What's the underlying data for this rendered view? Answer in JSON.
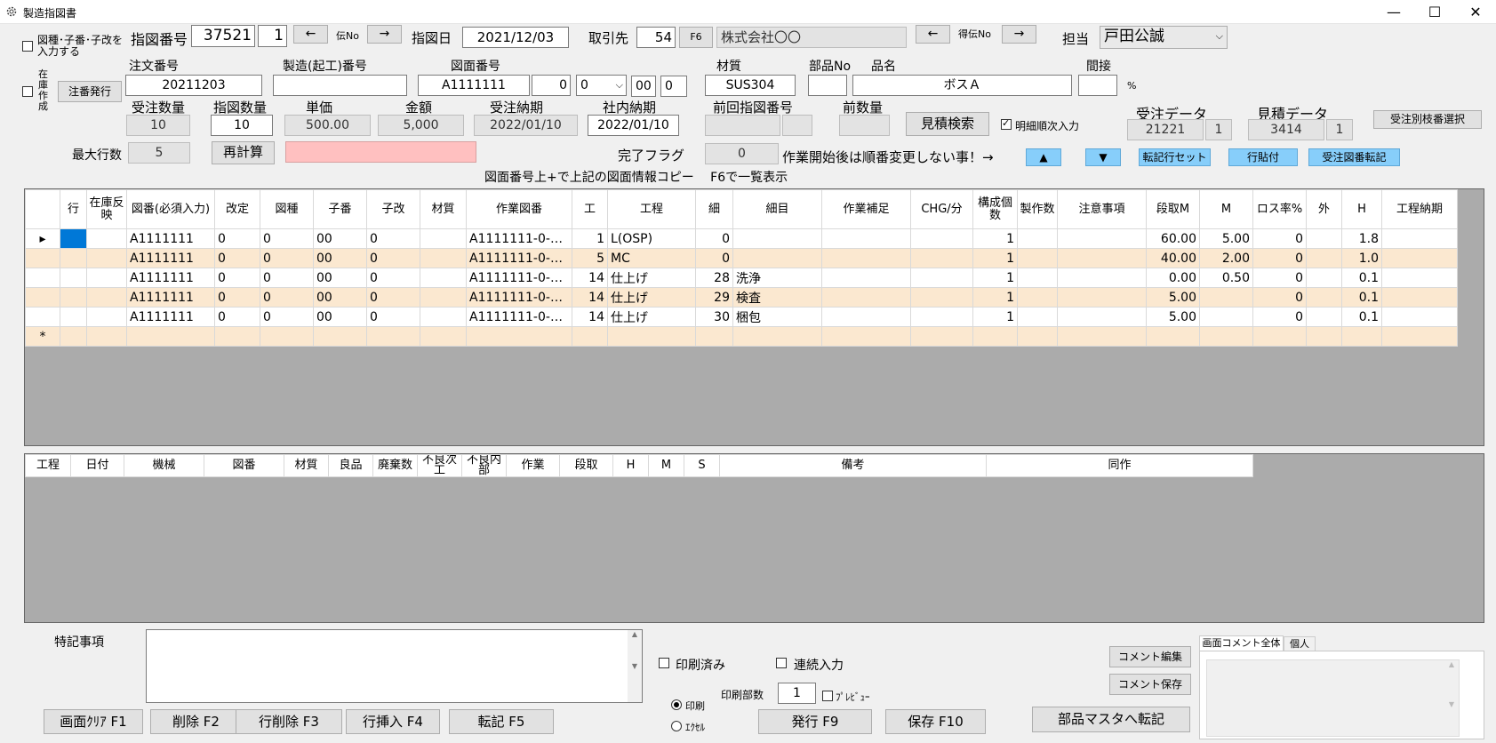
{
  "window": {
    "title": "製造指図書",
    "min": "—",
    "max": "☐",
    "close": "✕"
  },
  "top": {
    "chk_input_label": "図種･子番･子改を入力する",
    "chk_stock_label": "在庫作成",
    "order_issue_btn": "注番発行",
    "shizu_label": "指図番号",
    "shizu_no": "37521",
    "shizu_sub": "1",
    "arrow_left": "←",
    "arrow_right": "→",
    "den_no_label": "伝No",
    "date_label": "指図日",
    "date": "2021/12/03",
    "client_label": "取引先",
    "client_code": "54",
    "f6": "F6",
    "client_name": "株式会社〇〇",
    "tokuden_label": "得伝No",
    "tanto_label": "担当",
    "tanto": "戸田公誠"
  },
  "row2": {
    "order_no_label": "注文番号",
    "order_no": "20211203",
    "mfg_no_label": "製造(起工)番号",
    "mfg_no": "",
    "drawing_label": "図面番号",
    "drawing_no": "A1111111",
    "drawing_a": "0",
    "drawing_b": "0",
    "drawing_c": "00",
    "drawing_d": "0",
    "material_label": "材質",
    "material": "SUS304",
    "part_no_label": "部品No",
    "part_no": "",
    "name_label": "品名",
    "name": "ボスＡ",
    "indirect_label": "間接",
    "indirect": "",
    "percent": "%"
  },
  "row3": {
    "order_qty_label": "受注数量",
    "order_qty": "10",
    "shizu_qty_label": "指図数量",
    "shizu_qty": "10",
    "price_label": "単価",
    "price": "500.00",
    "amount_label": "金額",
    "amount": "5,000",
    "due_label": "受注納期",
    "due": "2022/01/10",
    "internal_due_label": "社内納期",
    "internal_due": "2022/01/10",
    "prev_label": "前回指図番号",
    "prev_a": "",
    "prev_b": "",
    "prev_qty_label": "前数量",
    "prev_qty": "",
    "estimate_search": "見積検索",
    "detail_order_label": "明細順次入力",
    "order_data_label": "受注データ",
    "order_data_a": "21221",
    "order_data_b": "1",
    "est_data_label": "見積データ",
    "est_data_a": "3414",
    "est_data_b": "1",
    "branch_select": "受注別枝番選択"
  },
  "row4": {
    "max_rows_label": "最大行数",
    "max_rows": "5",
    "recalc": "再計算",
    "done_flag_label": "完了フラグ",
    "done_flag": "0",
    "warning": "作業開始後は順番変更しない事！→",
    "up": "▲",
    "down": "▼",
    "set_btn": "転記行セット",
    "paste_btn": "行貼付",
    "transfer_btn": "受注図番転記",
    "hint": "図面番号上+で上記の図面情報コピー　 F6で一覧表示"
  },
  "grid1": {
    "headers": [
      "",
      "行",
      "在庫反映",
      "図番(必須入力)",
      "改定",
      "図種",
      "子番",
      "子改",
      "材質",
      "作業図番",
      "工",
      "工程",
      "細",
      "細目",
      "作業補足",
      "CHG/分",
      "構成個数",
      "製作数",
      "注意事項",
      "段取M",
      "M",
      "ロス率%",
      "外",
      "H",
      "工程納期"
    ],
    "rows": [
      [
        "▸",
        "",
        "",
        "A1111111",
        "0",
        "0",
        "00",
        "0",
        "",
        "A1111111-0-0...",
        "1",
        "L(OSP)",
        "0",
        "",
        "",
        "",
        "1",
        "",
        "",
        "60.00",
        "5.00",
        "0",
        "",
        "1.8",
        ""
      ],
      [
        "",
        "",
        "",
        "A1111111",
        "0",
        "0",
        "00",
        "0",
        "",
        "A1111111-0-0...",
        "5",
        "MC",
        "0",
        "",
        "",
        "",
        "1",
        "",
        "",
        "40.00",
        "2.00",
        "0",
        "",
        "1.0",
        ""
      ],
      [
        "",
        "",
        "",
        "A1111111",
        "0",
        "0",
        "00",
        "0",
        "",
        "A1111111-0-0...",
        "14",
        "仕上げ",
        "28",
        "洗浄",
        "",
        "",
        "1",
        "",
        "",
        "0.00",
        "0.50",
        "0",
        "",
        "0.1",
        ""
      ],
      [
        "",
        "",
        "",
        "A1111111",
        "0",
        "0",
        "00",
        "0",
        "",
        "A1111111-0-0...",
        "14",
        "仕上げ",
        "29",
        "検査",
        "",
        "",
        "1",
        "",
        "",
        "5.00",
        "",
        "0",
        "",
        "0.1",
        ""
      ],
      [
        "",
        "",
        "",
        "A1111111",
        "0",
        "0",
        "00",
        "0",
        "",
        "A1111111-0-0...",
        "14",
        "仕上げ",
        "30",
        "梱包",
        "",
        "",
        "1",
        "",
        "",
        "5.00",
        "",
        "0",
        "",
        "0.1",
        ""
      ]
    ],
    "new_row": "*"
  },
  "grid2": {
    "headers": [
      "工程",
      "日付",
      "機械",
      "図番",
      "材質",
      "良品",
      "廃棄数",
      "不良次工",
      "不良内部",
      "作業",
      "段取",
      "H",
      "M",
      "S",
      "備考",
      "同作"
    ]
  },
  "bottom": {
    "notes_label": "特記事項",
    "notes": "",
    "printed": "印刷済み",
    "continuous": "連続入力",
    "copies_label": "印刷部数",
    "copies": "1",
    "preview": "ﾌﾟﾚﾋﾞｭｰ",
    "print_radio": "印刷",
    "excel_radio": "ｴｸｾﾙ",
    "comment_edit": "コメント編集",
    "comment_save": "コメント保存",
    "tab_all": "画面コメント全体",
    "tab_personal": "個人",
    "clear": "画面ｸﾘｱ F1",
    "delete": "削除 F2",
    "row_delete": "行削除 F3",
    "row_insert": "行挿入 F4",
    "transfer": "転記 F5",
    "issue": "発行 F9",
    "save": "保存 F10",
    "to_master": "部品マスタへ転記"
  }
}
